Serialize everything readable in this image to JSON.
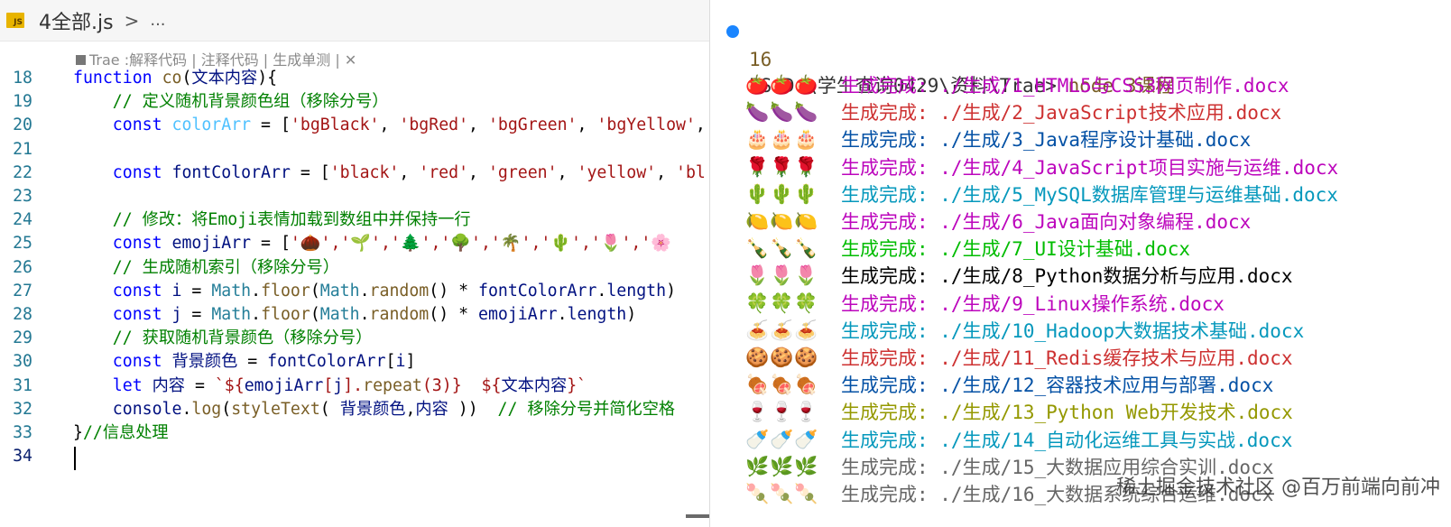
{
  "editor": {
    "tab_badge": "JS",
    "file_name": "4全部.js",
    "breadcrumb_chevron": ">",
    "breadcrumb_more": "...",
    "codelens": "Trae :解释代码 | 注释代码 | 生成单测 | ✕",
    "lines": [
      {
        "n": "18",
        "parts": [
          [
            "kw",
            "function "
          ],
          [
            "fn",
            "co"
          ],
          [
            "plain",
            "("
          ],
          [
            "var",
            "文本内容"
          ],
          [
            "plain",
            "){"
          ]
        ]
      },
      {
        "n": "19",
        "parts": [
          [
            "cmt",
            "    // 定义随机背景颜色组（移除分号）"
          ]
        ]
      },
      {
        "n": "20",
        "parts": [
          [
            "kw",
            "    const "
          ],
          [
            "mvar",
            "colorArr"
          ],
          [
            "plain",
            " = ["
          ],
          [
            "str",
            "'bgBlack'"
          ],
          [
            "plain",
            ", "
          ],
          [
            "str",
            "'bgRed'"
          ],
          [
            "plain",
            ", "
          ],
          [
            "str",
            "'bgGreen'"
          ],
          [
            "plain",
            ", "
          ],
          [
            "str",
            "'bgYellow'"
          ],
          [
            "plain",
            ","
          ]
        ]
      },
      {
        "n": "21",
        "parts": [
          [
            "plain",
            ""
          ]
        ]
      },
      {
        "n": "22",
        "parts": [
          [
            "kw",
            "    const "
          ],
          [
            "var",
            "fontColorArr"
          ],
          [
            "plain",
            " = ["
          ],
          [
            "str",
            "'black'"
          ],
          [
            "plain",
            ", "
          ],
          [
            "str",
            "'red'"
          ],
          [
            "plain",
            ", "
          ],
          [
            "str",
            "'green'"
          ],
          [
            "plain",
            ", "
          ],
          [
            "str",
            "'yellow'"
          ],
          [
            "plain",
            ", "
          ],
          [
            "str",
            "'bl"
          ]
        ]
      },
      {
        "n": "23",
        "parts": [
          [
            "plain",
            ""
          ]
        ]
      },
      {
        "n": "24",
        "parts": [
          [
            "cmt",
            "    // 修改：将Emoji表情加载到数组中并保持一行"
          ]
        ]
      },
      {
        "n": "25",
        "parts": [
          [
            "kw",
            "    const "
          ],
          [
            "var",
            "emojiArr"
          ],
          [
            "plain",
            " = ["
          ],
          [
            "str",
            "'🌰','🌱','🌲','🌳','🌴','🌵','🌷','🌸"
          ]
        ]
      },
      {
        "n": "26",
        "parts": [
          [
            "cmt",
            "    // 生成随机索引（移除分号）"
          ]
        ]
      },
      {
        "n": "27",
        "parts": [
          [
            "kw",
            "    const "
          ],
          [
            "var",
            "i"
          ],
          [
            "plain",
            " = "
          ],
          [
            "cls",
            "Math"
          ],
          [
            "plain",
            "."
          ],
          [
            "fn",
            "floor"
          ],
          [
            "plain",
            "("
          ],
          [
            "cls",
            "Math"
          ],
          [
            "plain",
            "."
          ],
          [
            "fn",
            "random"
          ],
          [
            "plain",
            "() * "
          ],
          [
            "var",
            "fontColorArr"
          ],
          [
            "plain",
            "."
          ],
          [
            "var",
            "length"
          ],
          [
            "plain",
            ")"
          ]
        ]
      },
      {
        "n": "28",
        "parts": [
          [
            "kw",
            "    const "
          ],
          [
            "var",
            "j"
          ],
          [
            "plain",
            " = "
          ],
          [
            "cls",
            "Math"
          ],
          [
            "plain",
            "."
          ],
          [
            "fn",
            "floor"
          ],
          [
            "plain",
            "("
          ],
          [
            "cls",
            "Math"
          ],
          [
            "plain",
            "."
          ],
          [
            "fn",
            "random"
          ],
          [
            "plain",
            "() * "
          ],
          [
            "var",
            "emojiArr"
          ],
          [
            "plain",
            "."
          ],
          [
            "var",
            "length"
          ],
          [
            "plain",
            ")"
          ]
        ]
      },
      {
        "n": "29",
        "parts": [
          [
            "cmt",
            "    // 获取随机背景颜色（移除分号）"
          ]
        ]
      },
      {
        "n": "30",
        "parts": [
          [
            "kw",
            "    const "
          ],
          [
            "var",
            "背景颜色"
          ],
          [
            "plain",
            " = "
          ],
          [
            "var",
            "fontColorArr"
          ],
          [
            "plain",
            "["
          ],
          [
            "var",
            "i"
          ],
          [
            "plain",
            "]"
          ]
        ]
      },
      {
        "n": "31",
        "parts": [
          [
            "kw",
            "    let "
          ],
          [
            "var",
            "内容"
          ],
          [
            "plain",
            " = "
          ],
          [
            "str",
            "`${"
          ],
          [
            "var",
            "emojiArr"
          ],
          [
            "str",
            "["
          ],
          [
            "var",
            "j"
          ],
          [
            "str",
            "]."
          ],
          [
            "fn",
            "repeat"
          ],
          [
            "str",
            "(3)}  ${"
          ],
          [
            "var",
            "文本内容"
          ],
          [
            "str",
            "}`"
          ]
        ]
      },
      {
        "n": "32",
        "parts": [
          [
            "var",
            "    console"
          ],
          [
            "plain",
            "."
          ],
          [
            "fn",
            "log"
          ],
          [
            "plain",
            "("
          ],
          [
            "fn",
            "styleText"
          ],
          [
            "plain",
            "( "
          ],
          [
            "var",
            "背景颜色"
          ],
          [
            "plain",
            ","
          ],
          [
            "var",
            "内容"
          ],
          [
            "plain",
            " ))  "
          ],
          [
            "cmt",
            "// 移除分号并简化空格"
          ]
        ]
      },
      {
        "n": "33",
        "parts": [
          [
            "plain",
            "}"
          ],
          [
            "cmt",
            "//信息处理"
          ]
        ]
      },
      {
        "n": "34",
        "parts": [
          [
            "plain",
            ""
          ]
        ]
      }
    ]
  },
  "terminal": {
    "prompt": "PS D:\\学生查询0429\\资料\\Trae> ",
    "command": "node 3课程",
    "count": "16",
    "rows": [
      {
        "emoji": "🍅",
        "color": "#bc05bc",
        "text": "生成完成: ./生成/1_HTML5与CSS3网页制作.docx"
      },
      {
        "emoji": "🍆",
        "color": "#cd3131",
        "text": "生成完成: ./生成/2_JavaScript技术应用.docx"
      },
      {
        "emoji": "🎂",
        "color": "#0451a5",
        "text": "生成完成: ./生成/3_Java程序设计基础.docx"
      },
      {
        "emoji": "🌹",
        "color": "#bc05bc",
        "text": "生成完成: ./生成/4_JavaScript项目实施与运维.docx"
      },
      {
        "emoji": "🌵",
        "color": "#0598bc",
        "text": "生成完成: ./生成/5_MySQL数据库管理与运维基础.docx"
      },
      {
        "emoji": "🍋",
        "color": "#bc05bc",
        "text": "生成完成: ./生成/6_Java面向对象编程.docx"
      },
      {
        "emoji": "🍾",
        "color": "#00bc00",
        "text": "生成完成: ./生成/7_UI设计基础.docx"
      },
      {
        "emoji": "🌷",
        "color": "#000000",
        "text": "生成完成: ./生成/8_Python数据分析与应用.docx"
      },
      {
        "emoji": "🍀",
        "color": "#bc05bc",
        "text": "生成完成: ./生成/9_Linux操作系统.docx"
      },
      {
        "emoji": "🍝",
        "color": "#0598bc",
        "text": "生成完成: ./生成/10_Hadoop大数据技术基础.docx"
      },
      {
        "emoji": "🍪",
        "color": "#cd3131",
        "text": "生成完成: ./生成/11_Redis缓存技术与应用.docx"
      },
      {
        "emoji": "🍖",
        "color": "#0451a5",
        "text": "生成完成: ./生成/12_容器技术应用与部署.docx"
      },
      {
        "emoji": "🍷",
        "color": "#949800",
        "text": "生成完成: ./生成/13_Python Web开发技术.docx"
      },
      {
        "emoji": "🍼",
        "color": "#0598bc",
        "text": "生成完成: ./生成/14_自动化运维工具与实战.docx"
      },
      {
        "emoji": "🌿",
        "color": "#666666",
        "text": "生成完成: ./生成/15_大数据应用综合实训.docx"
      },
      {
        "emoji": "🍡",
        "color": "#666666",
        "text": "生成完成: ./生成/16_大数据系统综合运维.docx"
      }
    ],
    "watermark": "稀土掘金技术社区 @百万前端向前冲"
  }
}
